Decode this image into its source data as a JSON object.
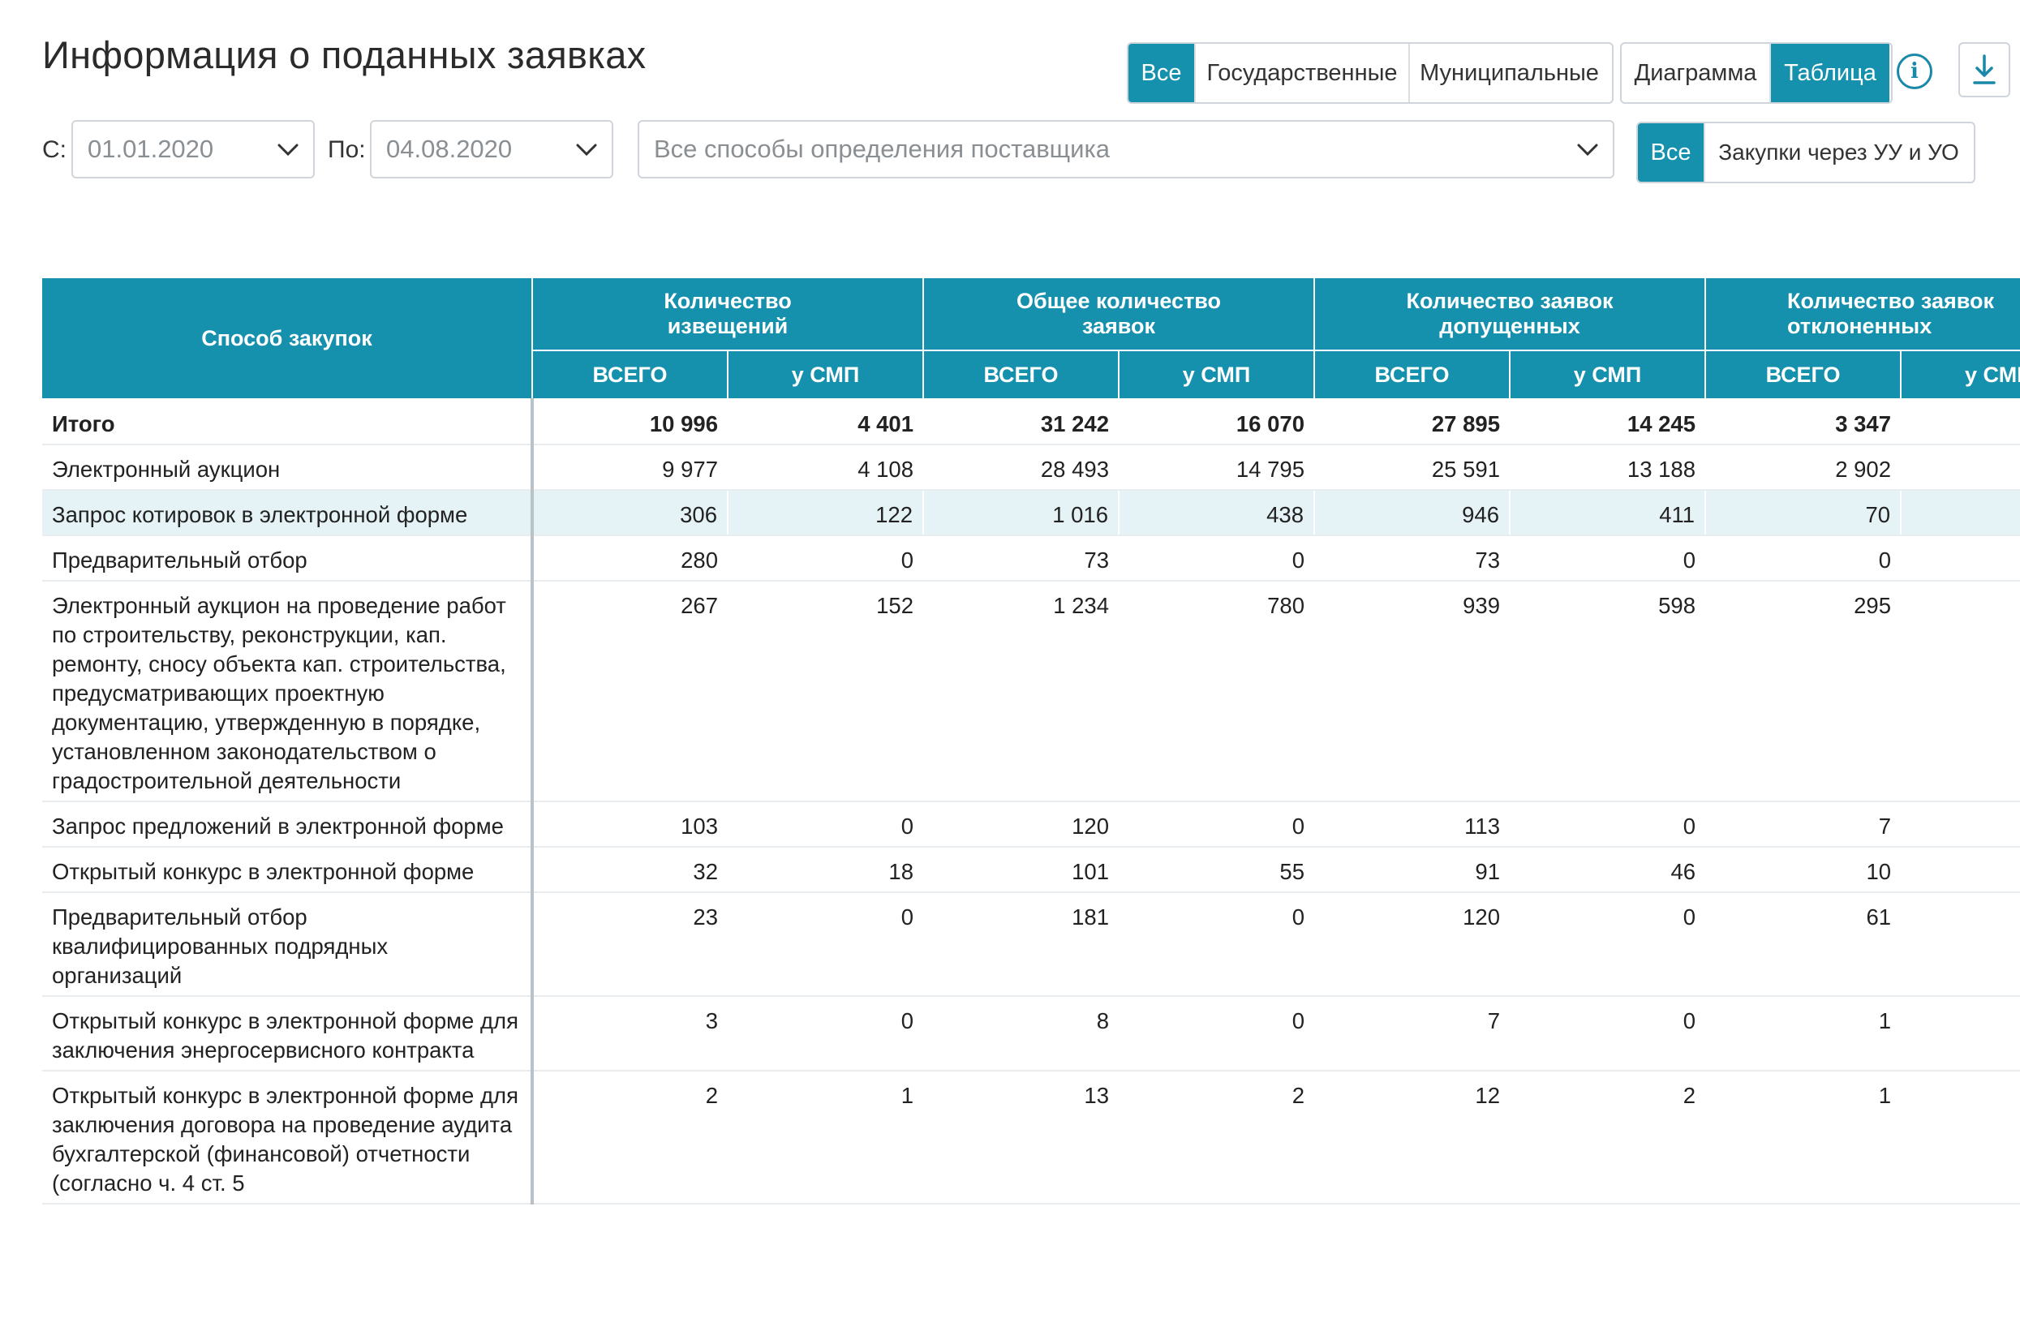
{
  "title": "Информация о поданных заявках",
  "filters": {
    "customer_type": [
      "Все",
      "Государственные",
      "Муниципальные"
    ],
    "view_mode": [
      "Диаграмма",
      "Таблица"
    ],
    "from_label": "С:",
    "from_value": "01.01.2020",
    "to_label": "По:",
    "to_value": "04.08.2020",
    "method_select": "Все способы определения поставщика",
    "purchase_scope": [
      "Все",
      "Закупки через УУ и УО"
    ]
  },
  "icons": {
    "info": "info-icon",
    "download": "download-icon",
    "dropdown": "chevron-down-icon"
  },
  "colors": {
    "accent": "#1590ad",
    "highlight_row": "#e5f2f6"
  },
  "table": {
    "col_method": "Способ закупок",
    "groups": [
      "Количество извещений",
      "Общее количество заявок",
      "Количество заявок допущенных",
      "Количество заявок отклоненных"
    ],
    "sub_total": "ВСЕГО",
    "sub_smp": "у СМП",
    "rows": [
      {
        "name": "Итого",
        "v": [
          "10 996",
          "4 401",
          "31 242",
          "16 070",
          "27 895",
          "14 245",
          "3 347",
          ""
        ]
      },
      {
        "name": "Электронный аукцион",
        "v": [
          "9 977",
          "4 108",
          "28 493",
          "14 795",
          "25 591",
          "13 188",
          "2 902",
          ""
        ]
      },
      {
        "name": "Запрос котировок в электронной форме",
        "v": [
          "306",
          "122",
          "1 016",
          "438",
          "946",
          "411",
          "70",
          ""
        ]
      },
      {
        "name": "Предварительный отбор",
        "v": [
          "280",
          "0",
          "73",
          "0",
          "73",
          "0",
          "0",
          ""
        ]
      },
      {
        "name": "Электронный аукцион на проведение работ по строительству, реконструкции, кап. ремонту, сносу объекта кап. строительства, предусматривающих проектную документацию, утвержденную в порядке, установленном законодательством о градостроительной деятельности",
        "v": [
          "267",
          "152",
          "1 234",
          "780",
          "939",
          "598",
          "295",
          ""
        ]
      },
      {
        "name": "Запрос предложений в электронной форме",
        "v": [
          "103",
          "0",
          "120",
          "0",
          "113",
          "0",
          "7",
          ""
        ]
      },
      {
        "name": "Открытый конкурс в электронной форме",
        "v": [
          "32",
          "18",
          "101",
          "55",
          "91",
          "46",
          "10",
          ""
        ]
      },
      {
        "name": "Предварительный отбор квалифицированных подрядных организаций",
        "v": [
          "23",
          "0",
          "181",
          "0",
          "120",
          "0",
          "61",
          ""
        ]
      },
      {
        "name": "Открытый конкурс в электронной форме для заключения энергосервисного контракта",
        "v": [
          "3",
          "0",
          "8",
          "0",
          "7",
          "0",
          "1",
          ""
        ]
      },
      {
        "name": "Открытый конкурс в электронной форме для заключения договора на проведение аудита бухгалтерской (финансовой) отчетности (согласно ч. 4 ст. 5",
        "v": [
          "2",
          "1",
          "13",
          "2",
          "12",
          "2",
          "1",
          ""
        ]
      }
    ]
  }
}
